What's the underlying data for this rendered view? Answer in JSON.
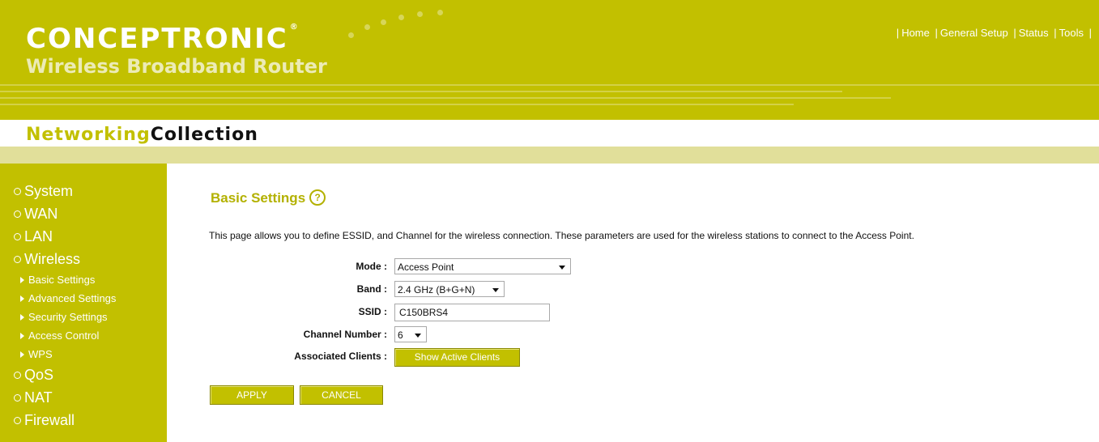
{
  "header": {
    "logo": "CONCEPTRONIC",
    "logo_mark": "®",
    "subtitle": "Wireless Broadband Router",
    "collection_part1": "Networking",
    "collection_part2": "Collection",
    "nav": [
      "Home",
      "General Setup",
      "Status",
      "Tools"
    ]
  },
  "sidebar": {
    "items": [
      {
        "label": "System"
      },
      {
        "label": "WAN"
      },
      {
        "label": "LAN"
      },
      {
        "label": "Wireless"
      },
      {
        "label": "QoS"
      },
      {
        "label": "NAT"
      },
      {
        "label": "Firewall"
      }
    ],
    "wireless_subitems": [
      {
        "label": "Basic Settings"
      },
      {
        "label": "Advanced Settings"
      },
      {
        "label": "Security Settings"
      },
      {
        "label": "Access Control"
      },
      {
        "label": "WPS"
      }
    ]
  },
  "main": {
    "title": "Basic Settings",
    "help_icon": "?",
    "description": "This page allows you to define ESSID, and Channel for the wireless connection. These parameters are used for the wireless stations to connect to the Access Point.",
    "form": {
      "mode_label": "Mode :",
      "mode_value": "Access Point",
      "band_label": "Band :",
      "band_value": "2.4 GHz (B+G+N)",
      "ssid_label": "SSID :",
      "ssid_value": "C150BRS4",
      "channel_label": "Channel Number :",
      "channel_value": "6",
      "clients_label": "Associated Clients :",
      "clients_button": "Show Active Clients"
    },
    "apply_label": "APPLY",
    "cancel_label": "CANCEL"
  },
  "colors": {
    "brand": "#c2c000",
    "light_bar": "#e1df9a",
    "title_text": "#b3b100"
  }
}
